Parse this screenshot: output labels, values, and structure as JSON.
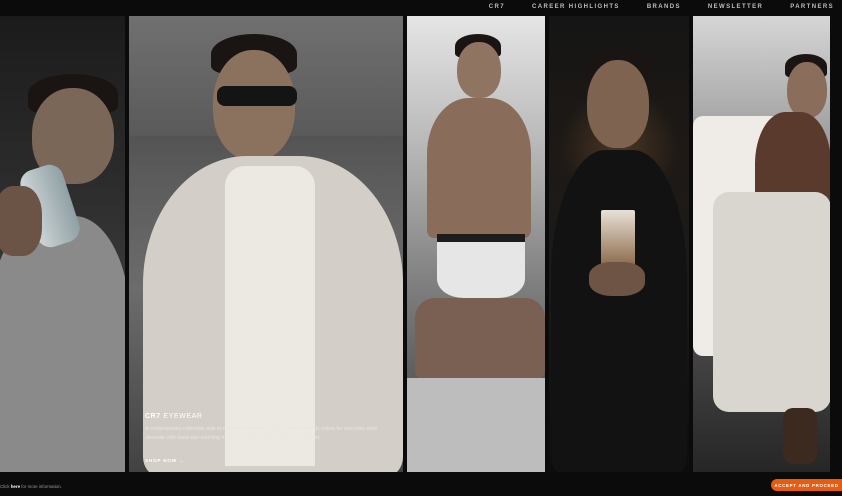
{
  "nav": {
    "items": [
      {
        "label": "CR7"
      },
      {
        "label": "CAREER HIGHLIGHTS"
      },
      {
        "label": "BRANDS"
      },
      {
        "label": "NEWSLETTER"
      },
      {
        "label": "PARTNERS"
      }
    ]
  },
  "feature": {
    "title_brand": "CR7",
    "title_rest": "EYEWEAR",
    "description": "A contemporary collection able to masterfully match any type of look: classic colors for everyday style alternate with more eye-catching tones or a style that does not go unnoticed.",
    "cta": "SHOP NOW",
    "cta_icon": "arrow-right-icon"
  },
  "cookie_bar": {
    "prefix": "Click",
    "link": "here",
    "suffix": "for more information.",
    "button": "ACCEPT AND PROCEED",
    "button_color": "#e85c10"
  },
  "panels": [
    {
      "subject": "water-bottle"
    },
    {
      "subject": "eyewear"
    },
    {
      "subject": "underwear"
    },
    {
      "subject": "fragrance-cr7"
    },
    {
      "subject": "apparel"
    }
  ]
}
